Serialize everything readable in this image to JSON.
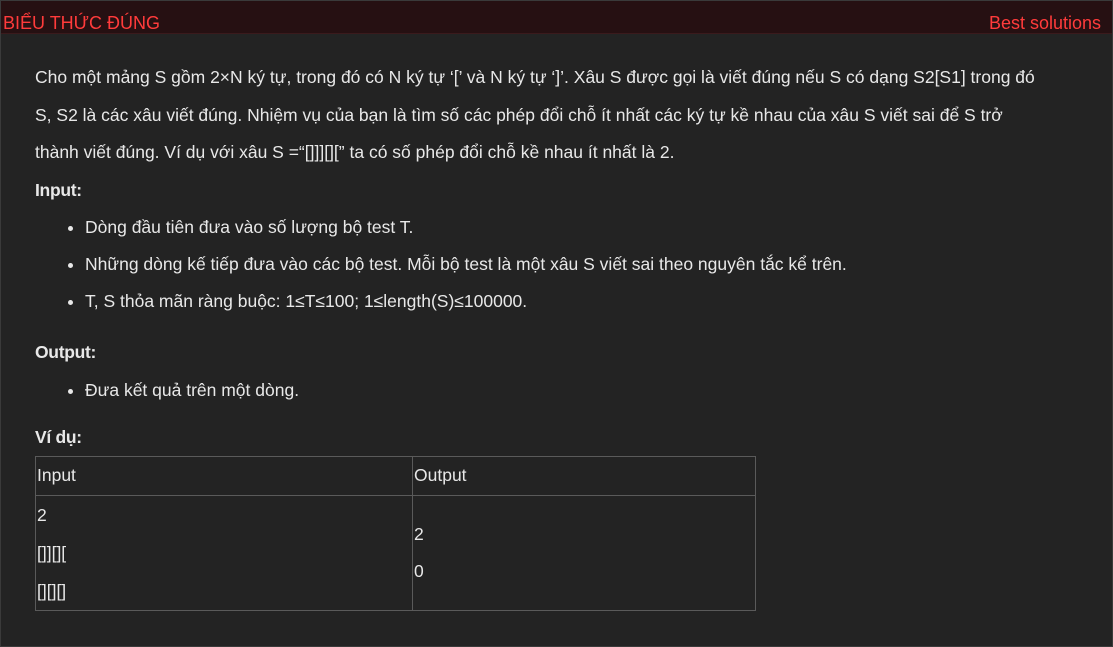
{
  "header": {
    "title": "BIỂU THỨC ĐÚNG",
    "best_solutions": "Best solutions"
  },
  "problem": {
    "statement": [
      "Cho một mảng S gồm 2×N ký tự, trong đó có N ký tự ‘[’ và N ký tự ‘]’. Xâu S được gọi là viết đúng nếu S có dạng S2[S1] trong đó",
      "S, S2 là các xâu viết đúng. Nhiệm vụ của bạn là tìm số các phép đổi chỗ ít nhất các ký tự kề nhau của xâu S viết sai để  S trở",
      "thành viết đúng. Ví dụ với xâu S =“[]]][][” ta có số phép đổi chỗ kề nhau ít nhất là 2."
    ],
    "input_heading": "Input:",
    "input_items": [
      "Dòng đầu tiên đưa vào số lượng bộ test T.",
      "Những dòng kế tiếp đưa vào các bộ test. Mỗi bộ test là một xâu S viết sai theo nguyên tắc kể trên.",
      "T, S thỏa mãn ràng buộc: 1≤T≤100; 1≤length(S)≤100000."
    ],
    "output_heading": "Output:",
    "output_items": [
      "Đưa kết quả trên một dòng."
    ],
    "example_heading": "Ví dụ:"
  },
  "example_table": {
    "headers": [
      "Input",
      "Output"
    ],
    "input_lines": [
      "2",
      "[]][][",
      "[][][]"
    ],
    "output_lines": [
      "2",
      "0"
    ]
  }
}
